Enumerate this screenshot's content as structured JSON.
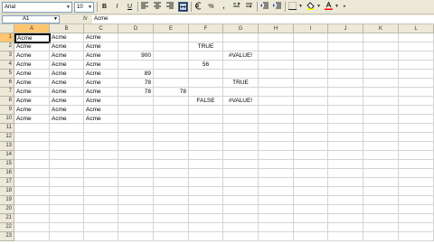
{
  "toolbar": {
    "font": "Arial",
    "size": "10",
    "buttons": {
      "bold": "B",
      "italic": "I",
      "underline": "U",
      "currency": "%",
      "comma": ","
    }
  },
  "formula_bar": {
    "name_box": "A1",
    "fx": "fx",
    "content": "Acme"
  },
  "columns": [
    "A",
    "B",
    "C",
    "D",
    "E",
    "F",
    "G",
    "H",
    "I",
    "J",
    "K",
    "L"
  ],
  "rows": [
    "1",
    "2",
    "3",
    "4",
    "5",
    "6",
    "7",
    "8",
    "9",
    "10",
    "11",
    "12",
    "13",
    "14",
    "15",
    "16",
    "17",
    "18",
    "19",
    "20",
    "21",
    "22",
    "23"
  ],
  "cells": {
    "r1": {
      "a": "Acme",
      "b": "Acme",
      "c": "Acme"
    },
    "r2": {
      "a": "Acme",
      "b": "Acme",
      "c": "Acme",
      "f": "TRUE"
    },
    "r3": {
      "a": "Acme",
      "b": "Acme",
      "c": "Acme",
      "d": "900",
      "g": "#VALUE!"
    },
    "r4": {
      "a": "Acme",
      "b": "Acme",
      "c": "Acme",
      "f": "56"
    },
    "r5": {
      "a": "Acme",
      "b": "Acme",
      "c": "Acme",
      "d": "89"
    },
    "r6": {
      "a": "Acme",
      "b": "Acme",
      "c": "Acme",
      "d": "78",
      "g": "TRUE"
    },
    "r7": {
      "a": "Acme",
      "b": "Acme",
      "c": "Acme",
      "d": "78",
      "e": "78"
    },
    "r8": {
      "a": "Acme",
      "b": "Acme",
      "c": "Acme",
      "f": "FALSE",
      "g": "#VALUE!"
    },
    "r9": {
      "a": "Acme",
      "b": "Acme",
      "c": "Acme"
    },
    "r10": {
      "a": "Acme",
      "b": "Acme",
      "c": "Acme"
    }
  }
}
